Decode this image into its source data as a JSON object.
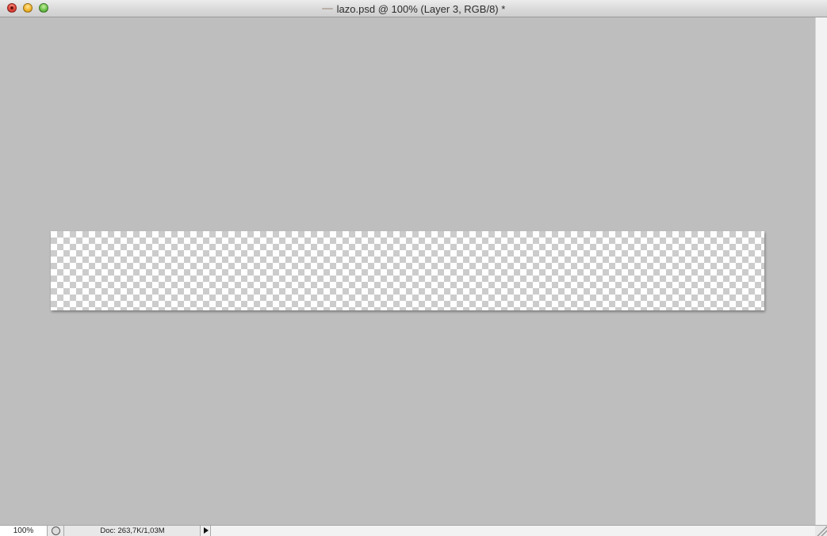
{
  "window": {
    "title": "lazo.psd @ 100% (Layer 3, RGB/8) *"
  },
  "status_bar": {
    "zoom": "100%",
    "doc_info": "Doc: 263,7K/1,03M"
  },
  "icons": {
    "close": "close-button",
    "minimize": "minimize-button",
    "zoom": "zoom-button",
    "proxy": "document-proxy-icon",
    "proof": "proof-setup-icon",
    "status_menu": "triangle-right-icon",
    "resize": "resize-grip-icon"
  },
  "colors": {
    "canvas_background": "#bebebe",
    "transparency_checker_light": "#ffffff",
    "transparency_checker_dark": "#cccccc",
    "close": "#e0443a",
    "minimize": "#f2b52d",
    "zoom": "#6cc24a"
  }
}
